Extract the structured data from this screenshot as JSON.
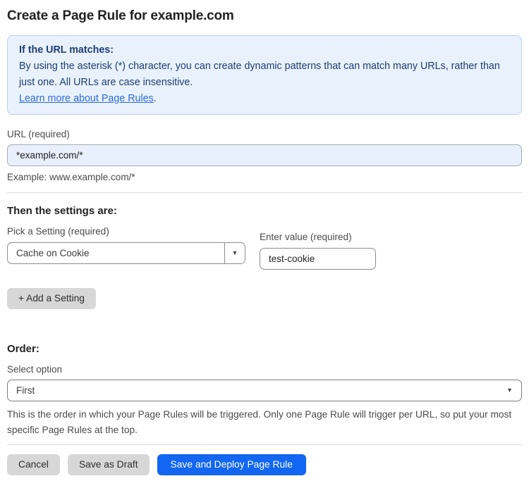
{
  "page": {
    "title": "Create a Page Rule for example.com"
  },
  "info_box": {
    "heading": "If the URL matches:",
    "body": "By using the asterisk (*) character, you can create dynamic patterns that can match many URLs, rather than just one. All URLs are case insensitive.",
    "link_label": "Learn more about Page Rules",
    "link_suffix": "."
  },
  "url_field": {
    "label": "URL (required)",
    "value": "*example.com/*",
    "example": "Example: www.example.com/*"
  },
  "settings": {
    "heading": "Then the settings are:",
    "setting_label": "Pick a Setting (required)",
    "setting_value": "Cache on Cookie",
    "value_label": "Enter value (required)",
    "value_value": "test-cookie",
    "add_button_label": "+ Add a Setting"
  },
  "order": {
    "heading": "Order:",
    "select_label": "Select option",
    "selected_option": "First",
    "help_text": "This is the order in which your Page Rules will be triggered. Only one Page Rule will trigger per URL, so put your most specific Page Rules at the top."
  },
  "footer": {
    "cancel_label": "Cancel",
    "save_draft_label": "Save as Draft",
    "save_deploy_label": "Save and Deploy Page Rule"
  },
  "icons": {
    "dropdown_arrow": "▼"
  },
  "colors": {
    "info_box_bg": "#e9f1fc",
    "info_box_border": "#b9d2f0",
    "info_box_text": "#1d3e74",
    "link": "#2c6bd9",
    "url_input_bg": "#e9f0fd",
    "primary_button": "#1266f1",
    "secondary_button": "#d7d7d7"
  }
}
